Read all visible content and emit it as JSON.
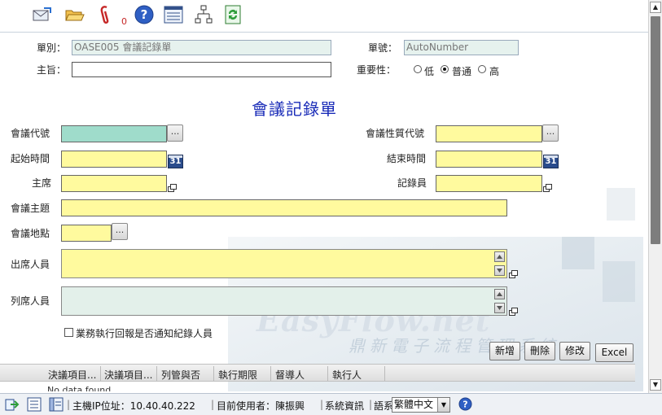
{
  "toolbar": {
    "attachment_count": "0",
    "icons": [
      "mail-icon",
      "open-folder-icon",
      "attachment-icon",
      "help-icon",
      "form-list-icon",
      "flowchart-icon",
      "refresh-icon"
    ]
  },
  "header": {
    "form_type_label": "單別：",
    "form_type_value": "OASE005 會議記錄單",
    "form_no_label": "單號：",
    "form_no_value": "AutoNumber",
    "subject_label": "主旨：",
    "subject_value": "",
    "priority_label": "重要性：",
    "priority_options": [
      {
        "label": "低",
        "selected": false
      },
      {
        "label": "普通",
        "selected": true
      },
      {
        "label": "高",
        "selected": false
      }
    ]
  },
  "form": {
    "title": "會議記錄單",
    "meeting_code_label": "會議代號",
    "meeting_type_code_label": "會議性質代號",
    "start_time_label": "起始時間",
    "end_time_label": "結束時間",
    "chair_label": "主席",
    "recorder_label": "記錄員",
    "topic_label": "會議主題",
    "location_label": "會議地點",
    "attendees_label": "出席人員",
    "observers_label": "列席人員",
    "notify_checkbox_label": "業務執行回報是否通知紀錄人員",
    "calendar_day": "31",
    "dots": "..."
  },
  "watermark": {
    "line1": "EasyFlow.net",
    "line2": "鼎新電子流程管理系統"
  },
  "buttons": {
    "add": "新增",
    "delete": "刪除",
    "edit": "修改",
    "excel": "Excel"
  },
  "grid": {
    "columns": [
      "決議項目...",
      "決議項目...",
      "列管與否",
      "執行期限",
      "督導人",
      "執行人"
    ],
    "empty_text": "No data found"
  },
  "status_bar": {
    "host_ip": "主機IP位址：10.40.40.222",
    "current_user": "目前使用者：陳振興",
    "system_info": "系統資訊",
    "language_label": "語系選擇",
    "language_value": "繁體中文",
    "separator": "|"
  },
  "colors": {
    "required_field": "#fffa9e",
    "key_field": "#9fdccb",
    "title": "#1a2cb8"
  }
}
